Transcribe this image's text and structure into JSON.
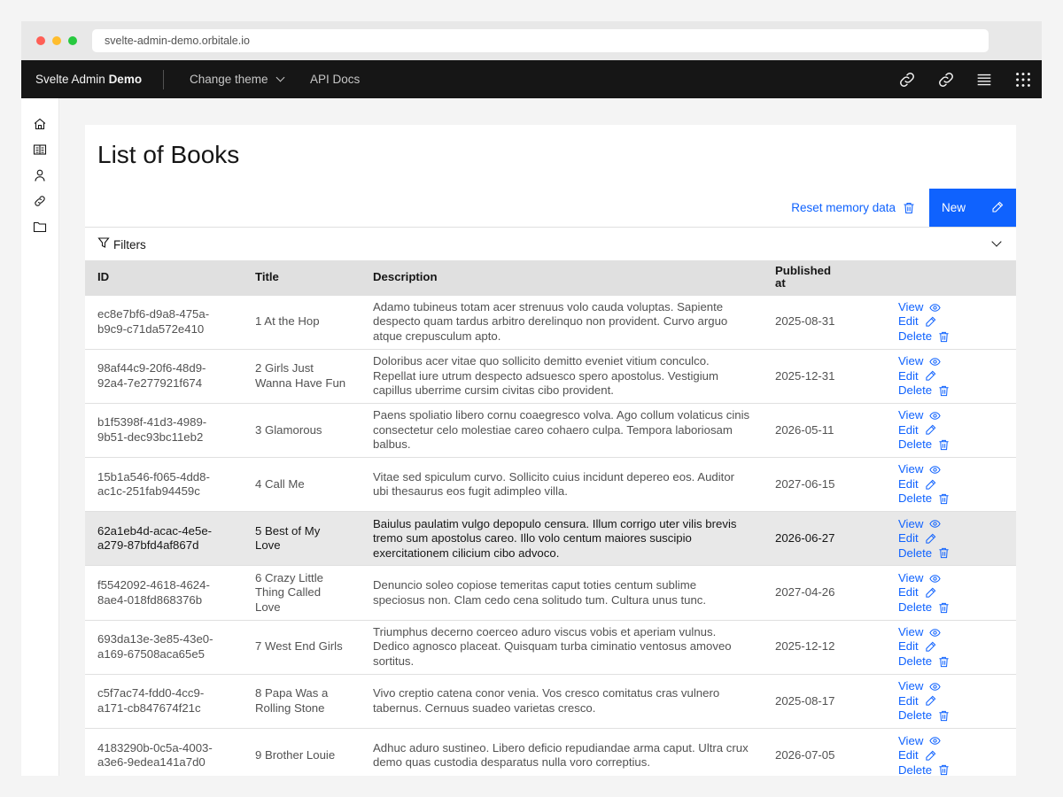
{
  "browser": {
    "url": "svelte-admin-demo.orbitale.io"
  },
  "topnav": {
    "brand_prefix": "Svelte Admin",
    "brand_strong": "Demo",
    "theme_label": "Change theme",
    "docs_label": "API Docs"
  },
  "page": {
    "title": "List of Books",
    "reset_label": "Reset memory data",
    "new_label": "New",
    "filters_label": "Filters"
  },
  "table": {
    "headers": {
      "id": "ID",
      "title": "Title",
      "description": "Description",
      "published": "Published at"
    },
    "actions": {
      "view": "View",
      "edit": "Edit",
      "delete": "Delete"
    },
    "rows": [
      {
        "id": "ec8e7bf6-d9a8-475a-b9c9-c71da572e410",
        "title": "1 At the Hop",
        "description": "Adamo tubineus totam acer strenuus volo cauda voluptas. Sapiente despecto quam tardus arbitro derelinquo non provident. Curvo arguo atque crepusculum apto.",
        "published": "2025-08-31"
      },
      {
        "id": "98af44c9-20f6-48d9-92a4-7e277921f674",
        "title": "2 Girls Just Wanna Have Fun",
        "description": "Doloribus acer vitae quo sollicito demitto eveniet vitium conculco. Repellat iure utrum despecto adsuesco spero apostolus. Vestigium capillus uberrime cursim civitas cibo provident.",
        "published": "2025-12-31"
      },
      {
        "id": "b1f5398f-41d3-4989-9b51-dec93bc11eb2",
        "title": "3 Glamorous",
        "description": "Paens spoliatio libero cornu coaegresco volva. Ago collum volaticus cinis consectetur celo molestiae careo cohaero culpa. Tempora laboriosam balbus.",
        "published": "2026-05-11"
      },
      {
        "id": "15b1a546-f065-4dd8-ac1c-251fab94459c",
        "title": "4 Call Me",
        "description": "Vitae sed spiculum curvo. Sollicito cuius incidunt depereo eos. Auditor ubi thesaurus eos fugit adimpleo villa.",
        "published": "2027-06-15"
      },
      {
        "id": "62a1eb4d-acac-4e5e-a279-87bfd4af867d",
        "title": "5 Best of My Love",
        "description": "Baiulus paulatim vulgo depopulo censura. Illum corrigo uter vilis brevis tremo sum apostolus careo. Illo volo centum maiores suscipio exercitationem cilicium cibo advoco.",
        "published": "2026-06-27"
      },
      {
        "id": "f5542092-4618-4624-8ae4-018fd868376b",
        "title": "6 Crazy Little Thing Called Love",
        "description": "Denuncio soleo copiose temeritas caput toties centum sublime speciosus non. Clam cedo cena solitudo tum. Cultura unus tunc.",
        "published": "2027-04-26"
      },
      {
        "id": "693da13e-3e85-43e0-a169-67508aca65e5",
        "title": "7 West End Girls",
        "description": "Triumphus decerno coerceo aduro viscus vobis et aperiam vulnus. Dedico agnosco placeat. Quisquam turba ciminatio ventosus amoveo sortitus.",
        "published": "2025-12-12"
      },
      {
        "id": "c5f7ac74-fdd0-4cc9-a171-cb847674f21c",
        "title": "8 Papa Was a Rolling Stone",
        "description": "Vivo creptio catena conor venia. Vos cresco comitatus cras vulnero tabernus. Cernuus suadeo varietas cresco.",
        "published": "2025-08-17"
      },
      {
        "id": "4183290b-0c5a-4003-a3e6-9edea141a7d0",
        "title": "9 Brother Louie",
        "description": "Adhuc aduro sustineo. Libero deficio repudiandae arma caput. Ultra crux demo quas custodia desparatus nulla voro correptius.",
        "published": "2026-07-05"
      }
    ]
  }
}
